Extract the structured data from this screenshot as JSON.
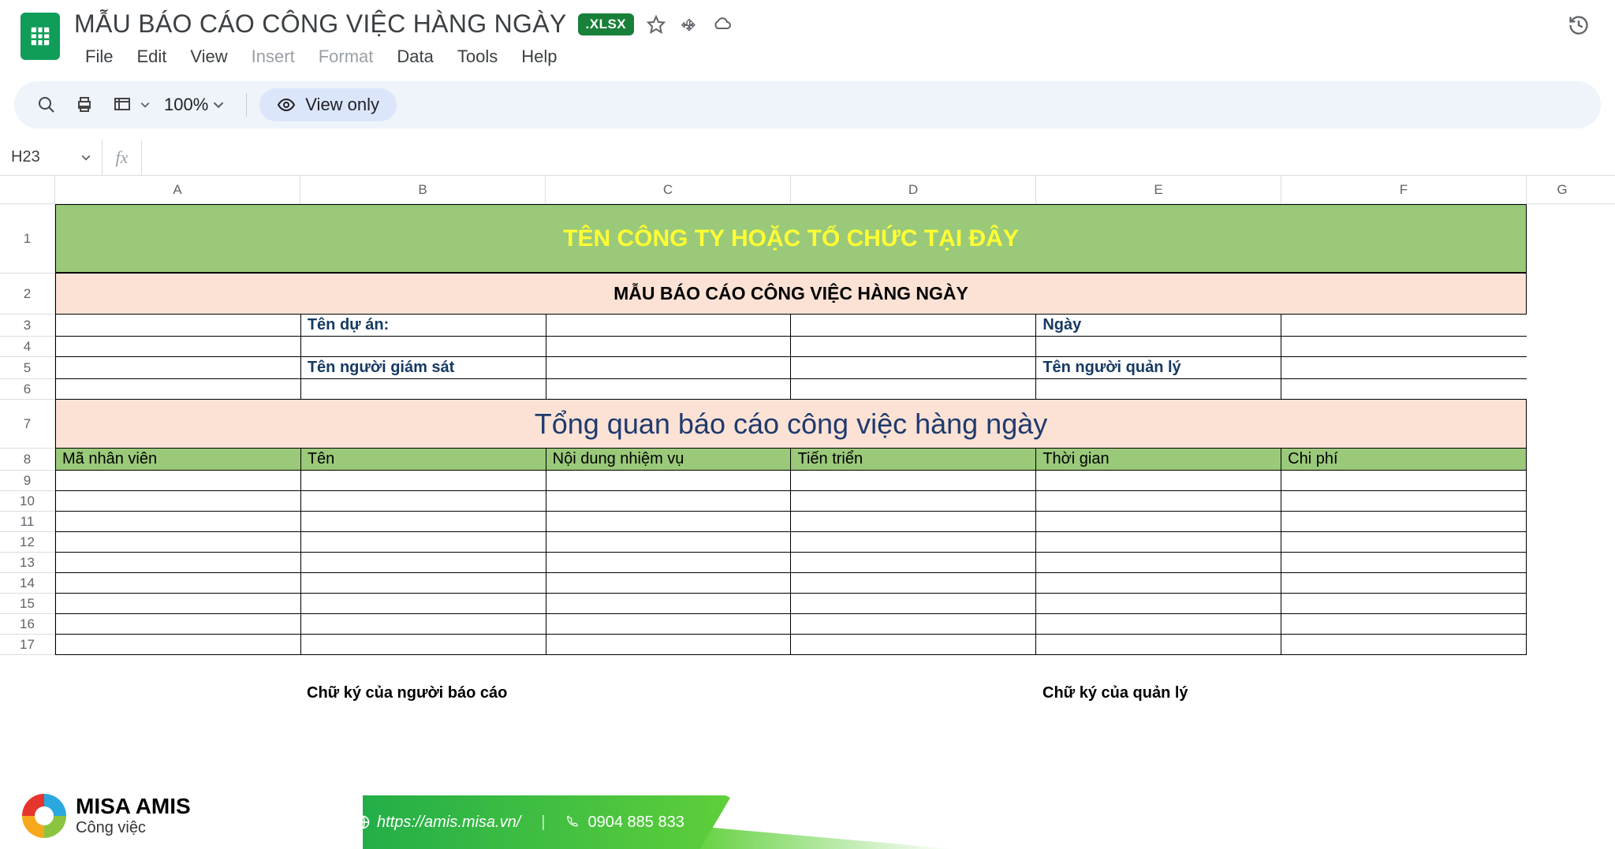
{
  "doc": {
    "title": "MẪU BÁO CÁO CÔNG VIỆC HÀNG NGÀY",
    "badge": ".XLSX"
  },
  "menu": {
    "file": "File",
    "edit": "Edit",
    "view": "View",
    "insert": "Insert",
    "format": "Format",
    "data": "Data",
    "tools": "Tools",
    "help": "Help"
  },
  "toolbar": {
    "zoom": "100%",
    "viewonly": "View only"
  },
  "namebox": "H23",
  "columns": [
    "A",
    "B",
    "C",
    "D",
    "E",
    "F",
    "G"
  ],
  "rows": [
    "1",
    "2",
    "3",
    "4",
    "5",
    "6",
    "7",
    "8",
    "9",
    "10",
    "11",
    "12",
    "13",
    "14",
    "15",
    "16",
    "17"
  ],
  "sheet": {
    "banner": "TÊN CÔNG TY HOẶC TỔ CHỨC TẠI ĐÂY",
    "subtitle": "MẪU BÁO CÁO CÔNG VIỆC HÀNG NGÀY",
    "project_label": "Tên dự án:",
    "date_label": "Ngày",
    "supervisor_label": "Tên người giám sát",
    "manager_label": "Tên người quản lý",
    "overview": "Tổng quan báo cáo công việc hàng ngày",
    "headers": {
      "emp_id": "Mã nhân viên",
      "name": "Tên",
      "task": "Nội dung nhiệm vụ",
      "progress": "Tiến triển",
      "time": "Thời gian",
      "cost": "Chi phí"
    },
    "sig_reporter": "Chữ ký của người báo cáo",
    "sig_manager": "Chữ ký của quản lý"
  },
  "footer": {
    "brand": "MISA AMIS",
    "brand_sub": "Công việc",
    "url": "https://amis.misa.vn/",
    "phone": "0904 885 833"
  }
}
